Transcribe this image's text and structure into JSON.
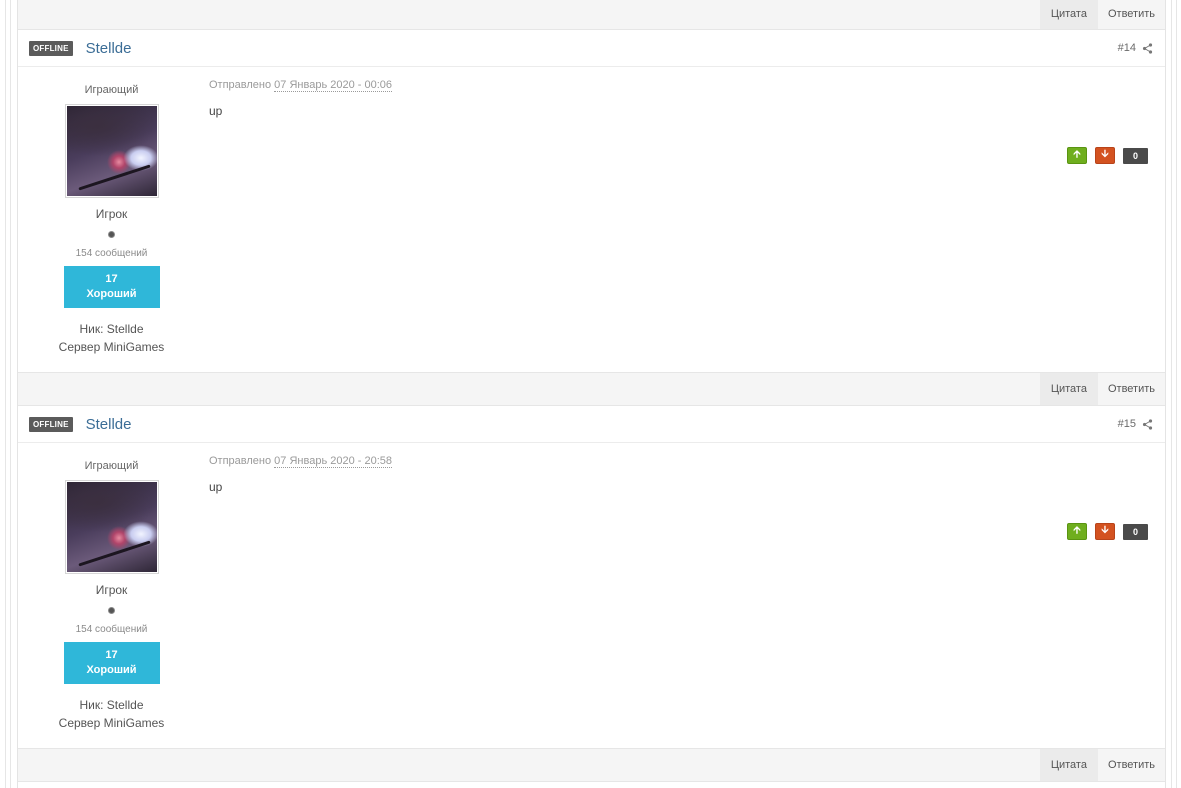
{
  "bars": {
    "quote_label": "Цитата",
    "reply_label": "Ответить"
  },
  "posts": [
    {
      "status": "OFFLINE",
      "author": "Stellde",
      "post_number": "#14",
      "group": "Играющий",
      "rank": "Игрок",
      "post_count": "154 сообщений",
      "reputation_value": "17",
      "reputation_label": "Хороший",
      "nick_label": "Ник:",
      "nick_value": "Stellde",
      "server_label": "Сервер",
      "server_value": "MiniGames",
      "posted_label": "Отправлено",
      "posted_date": "07 Январь 2020 - 00:06",
      "text": "up",
      "vote_count": "0"
    },
    {
      "status": "OFFLINE",
      "author": "Stellde",
      "post_number": "#15",
      "group": "Играющий",
      "rank": "Игрок",
      "post_count": "154 сообщений",
      "reputation_value": "17",
      "reputation_label": "Хороший",
      "nick_label": "Ник:",
      "nick_value": "Stellde",
      "server_label": "Сервер",
      "server_value": "MiniGames",
      "posted_label": "Отправлено",
      "posted_date": "07 Январь 2020 - 20:58",
      "text": "up",
      "vote_count": "0"
    }
  ],
  "icons": {
    "share": "share-icon",
    "vote_up": "arrow-up-icon",
    "vote_down": "arrow-down-icon"
  },
  "colors": {
    "reputation_bg": "#2fb7d9",
    "vote_up": "#6fae1e",
    "vote_down": "#d35220",
    "author_link": "#3b6d96",
    "offline_badge": "#5b5b5b"
  }
}
